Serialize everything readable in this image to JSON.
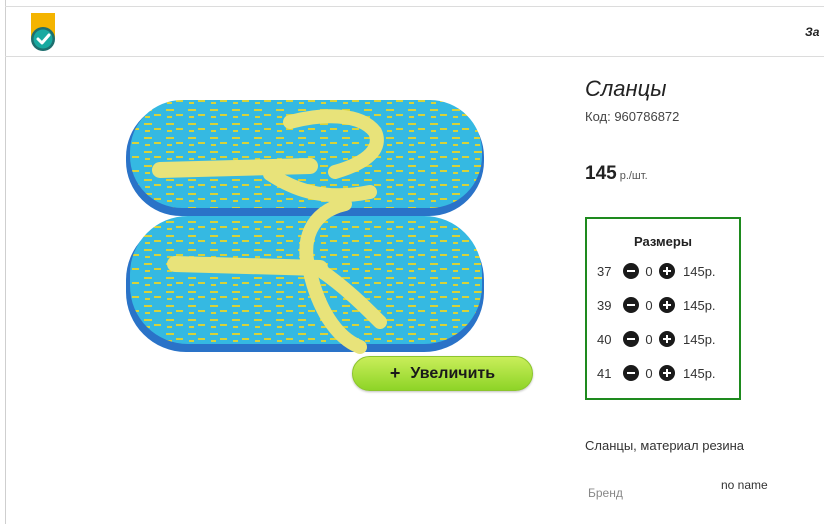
{
  "header": {
    "logo_icon": "checkmark-badge-icon",
    "nav_cut_text": "За"
  },
  "product": {
    "title": "Сланцы",
    "code": "Код: 960786872",
    "price": "145",
    "price_unit": "р./шт.",
    "zoom_button": "Увеличить",
    "zoom_icon": "plus-icon",
    "description": "Сланцы, материал резина",
    "brand_label": "Бренд",
    "brand_value": "no name"
  },
  "sizes": {
    "title": "Размеры",
    "rows": [
      {
        "size": "37",
        "qty": "0",
        "price": "145р."
      },
      {
        "size": "39",
        "qty": "0",
        "price": "145р."
      },
      {
        "size": "40",
        "qty": "0",
        "price": "145р."
      },
      {
        "size": "41",
        "qty": "0",
        "price": "145р."
      }
    ]
  },
  "colors": {
    "accent_green": "#1e8a1e",
    "button_green": "#9edc33",
    "sandal_blue": "#2fb6e0",
    "strap_yellow": "#f2e96a"
  }
}
